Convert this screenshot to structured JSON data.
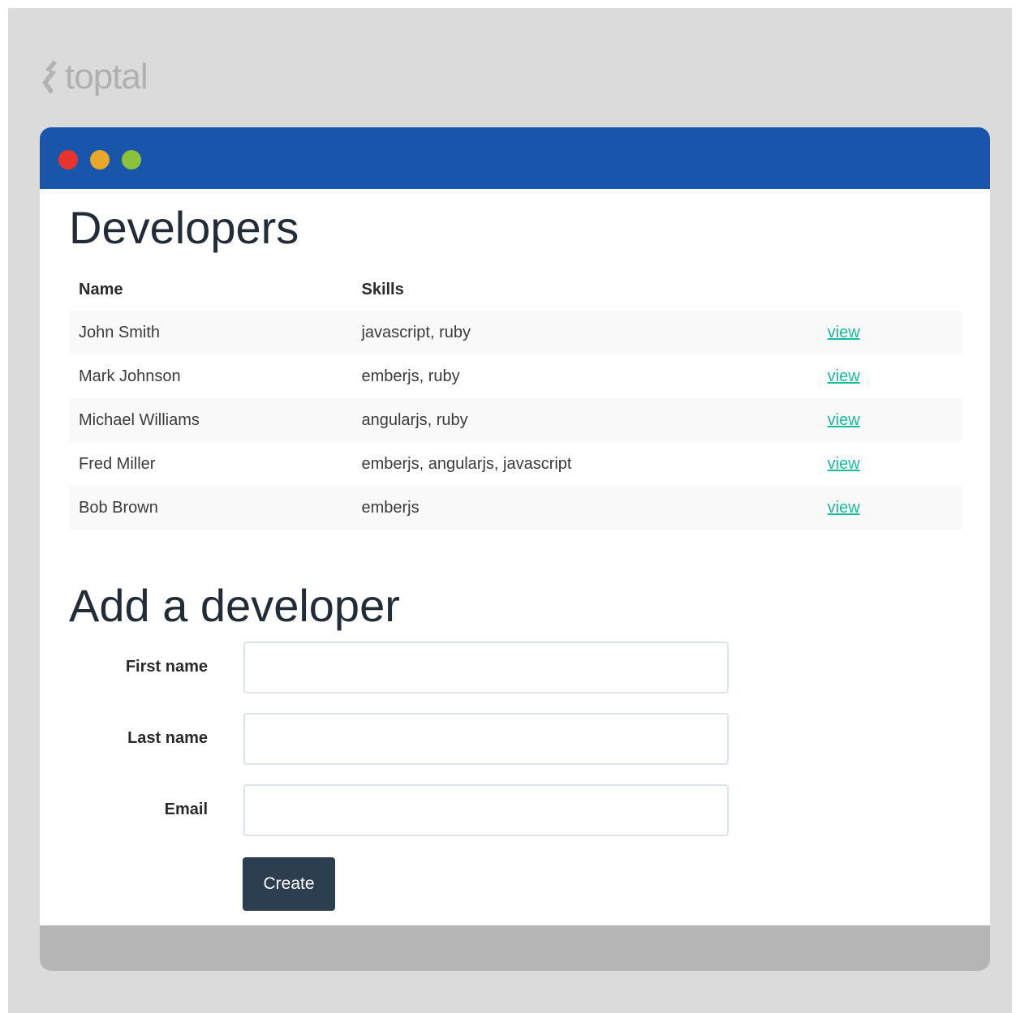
{
  "brand": {
    "logo_text": "toptal"
  },
  "window_controls": [
    "close",
    "minimize",
    "maximize"
  ],
  "colors": {
    "titlebar": "#1955ab",
    "close_dot": "#e8342c",
    "minimize_dot": "#e8a82b",
    "maximize_dot": "#8bc13b",
    "link": "#18bc9c",
    "button": "#2c3e50"
  },
  "developers": {
    "title": "Developers",
    "columns": {
      "name": "Name",
      "skills": "Skills"
    },
    "rows": [
      {
        "name": "John Smith",
        "skills": "javascript, ruby",
        "action": "view"
      },
      {
        "name": "Mark Johnson",
        "skills": "emberjs, ruby",
        "action": "view"
      },
      {
        "name": "Michael Williams",
        "skills": "angularjs, ruby",
        "action": "view"
      },
      {
        "name": "Fred Miller",
        "skills": "emberjs, angularjs, javascript",
        "action": "view"
      },
      {
        "name": "Bob Brown",
        "skills": "emberjs",
        "action": "view"
      }
    ]
  },
  "add_form": {
    "title": "Add a developer",
    "first_name_label": "First name",
    "first_name_value": "",
    "last_name_label": "Last name",
    "last_name_value": "",
    "email_label": "Email",
    "email_value": "",
    "submit_label": "Create"
  }
}
